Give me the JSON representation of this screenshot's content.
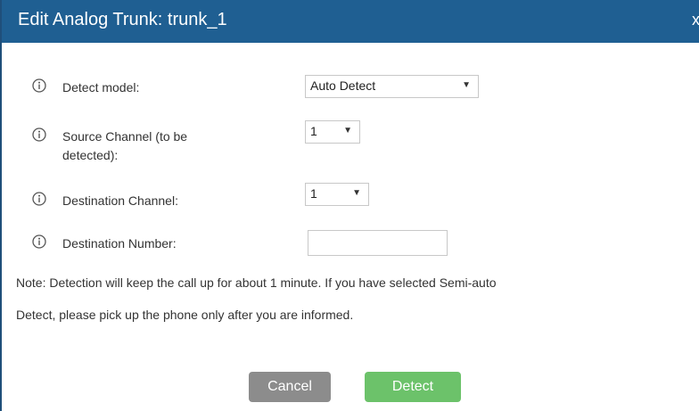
{
  "dialog": {
    "title": "Edit Analog Trunk: trunk_1",
    "close_label": "x"
  },
  "form": {
    "detect_model": {
      "label": "Detect model:",
      "value": "Auto Detect"
    },
    "source_channel": {
      "label_line1": "Source Channel (to be",
      "label_line2": "detected):",
      "value": "1"
    },
    "destination_channel": {
      "label": "Destination Channel:",
      "value": "1"
    },
    "destination_number": {
      "label": "Destination Number:",
      "value": ""
    }
  },
  "note": {
    "line1": "Note: Detection will keep the call up for about 1 minute. If you have selected Semi-auto",
    "line2": "Detect, please pick up the phone only after you are informed."
  },
  "buttons": {
    "cancel": "Cancel",
    "detect": "Detect"
  },
  "icons": {
    "info": "info-circle-icon",
    "dropdown": "chevron-down-icon"
  },
  "colors": {
    "titlebar": "#1f5f92",
    "cancel_button": "#8c8c8c",
    "detect_button": "#6cc26a"
  }
}
